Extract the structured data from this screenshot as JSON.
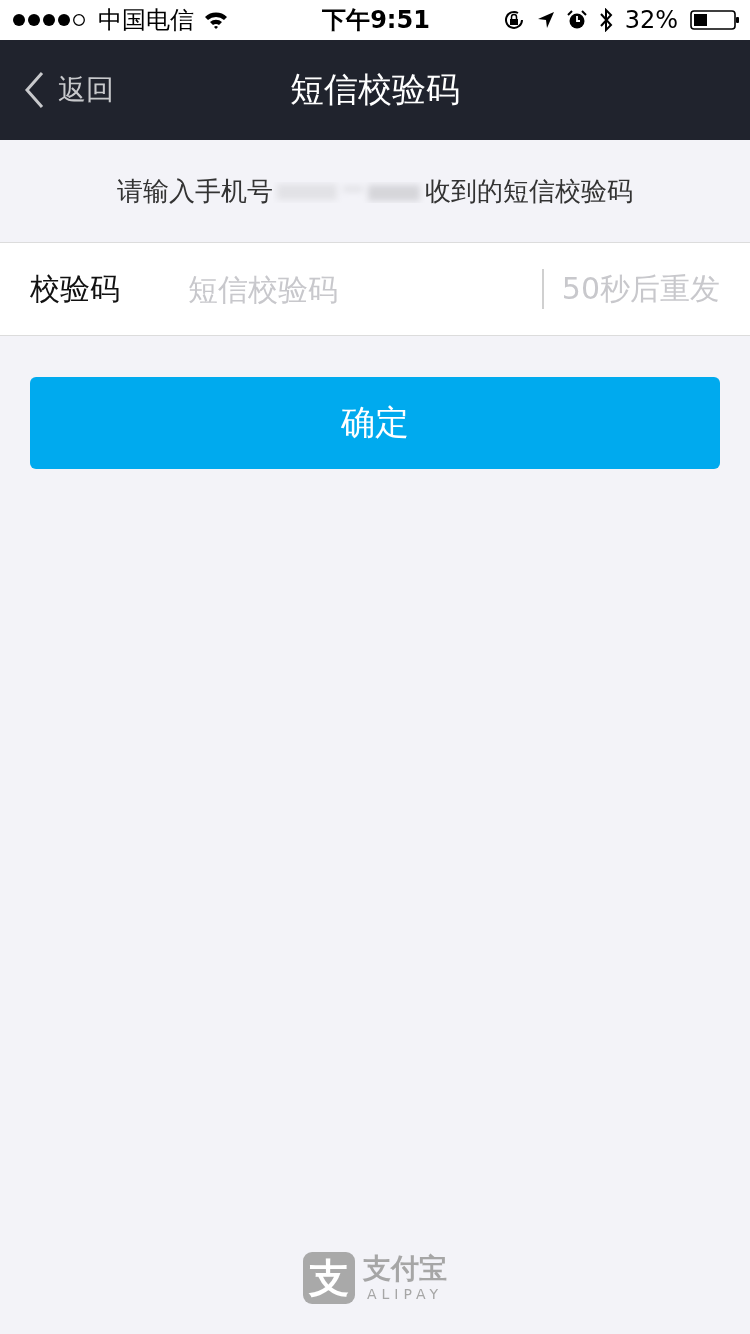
{
  "status_bar": {
    "carrier": "中国电信",
    "time": "下午9:51",
    "battery_percent": "32%"
  },
  "nav_bar": {
    "back_label": "返回",
    "title": "短信校验码"
  },
  "instruction": {
    "before": "请输入手机号",
    "after": "收到的短信校验码"
  },
  "code_field": {
    "label": "校验码",
    "placeholder": "短信校验码",
    "resend": "50秒后重发",
    "resend_disabled": true
  },
  "confirm_button": "确定",
  "footer_logo": {
    "mark": "支",
    "name": "支付宝",
    "latin": "ALIPAY"
  }
}
